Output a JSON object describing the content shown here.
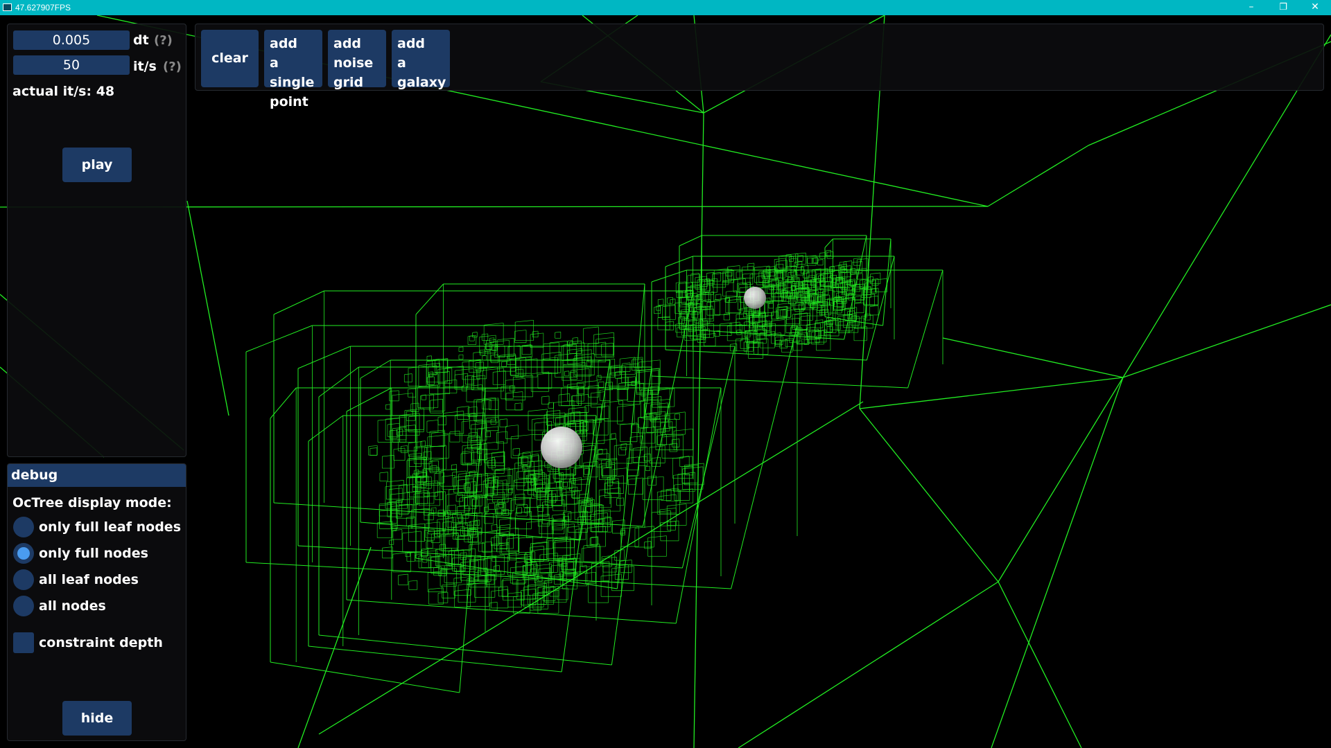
{
  "window": {
    "title": "47.627907FPS",
    "minimize_glyph": "–",
    "maximize_glyph": "❐",
    "close_glyph": "✕"
  },
  "sim": {
    "dt_value": "0.005",
    "dt_label": "dt",
    "dt_help": "(?)",
    "its_value": "50",
    "its_label": "it/s",
    "its_help": "(?)",
    "actual_its": "actual it/s: 48",
    "play_label": "play"
  },
  "toolbar": {
    "clear_label": "clear",
    "add_point_label": "add\na single\npoint",
    "add_noise_label": "add\nnoise\ngrid",
    "add_galaxy_label": "add\na\ngalaxy"
  },
  "debug": {
    "header": "debug",
    "mode_label": "OcTree display mode:",
    "options": [
      {
        "label": "only full leaf nodes",
        "selected": false
      },
      {
        "label": "only full nodes",
        "selected": true
      },
      {
        "label": "all leaf nodes",
        "selected": false
      },
      {
        "label": "all nodes",
        "selected": false
      }
    ],
    "constraint_label": "constraint depth",
    "constraint_checked": false,
    "hide_label": "hide"
  },
  "colors": {
    "titlebar": "#00b7c3",
    "button": "#1d3a64",
    "radio_selected": "#4a9cf0",
    "wireframe": "#22ee22",
    "background": "#000000"
  }
}
